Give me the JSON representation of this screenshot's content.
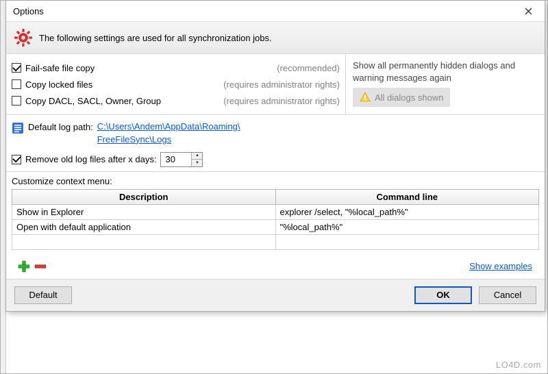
{
  "window": {
    "title": "Options"
  },
  "header": {
    "message": "The following settings are used for all synchronization jobs."
  },
  "options": {
    "failsafe": {
      "label": "Fail-safe file copy",
      "hint": "(recommended)",
      "checked": true
    },
    "copylocked": {
      "label": "Copy locked files",
      "hint": "(requires administrator rights)",
      "checked": false
    },
    "copydacl": {
      "label": "Copy DACL, SACL, Owner, Group",
      "hint": "(requires administrator rights)",
      "checked": false
    }
  },
  "hidden_dialogs": {
    "message": "Show all permanently hidden dialogs and warning messages again",
    "button": "All dialogs shown"
  },
  "log": {
    "label": "Default log path:",
    "path_line1": "C:\\Users\\Andem\\AppData\\Roaming\\",
    "path_line2": "FreeFileSync\\Logs",
    "remove_label": "Remove old log files after x days:",
    "remove_checked": true,
    "days": "30"
  },
  "context_menu": {
    "label": "Customize context menu:",
    "headers": {
      "desc": "Description",
      "cmd": "Command line"
    },
    "rows": [
      {
        "desc": "Show in Explorer",
        "cmd": "explorer /select, \"%local_path%\""
      },
      {
        "desc": "Open with default application",
        "cmd": "\"%local_path%\""
      },
      {
        "desc": "",
        "cmd": ""
      }
    ],
    "show_examples": "Show examples"
  },
  "buttons": {
    "default": "Default",
    "ok": "OK",
    "cancel": "Cancel"
  },
  "watermark": "LO4D.com"
}
